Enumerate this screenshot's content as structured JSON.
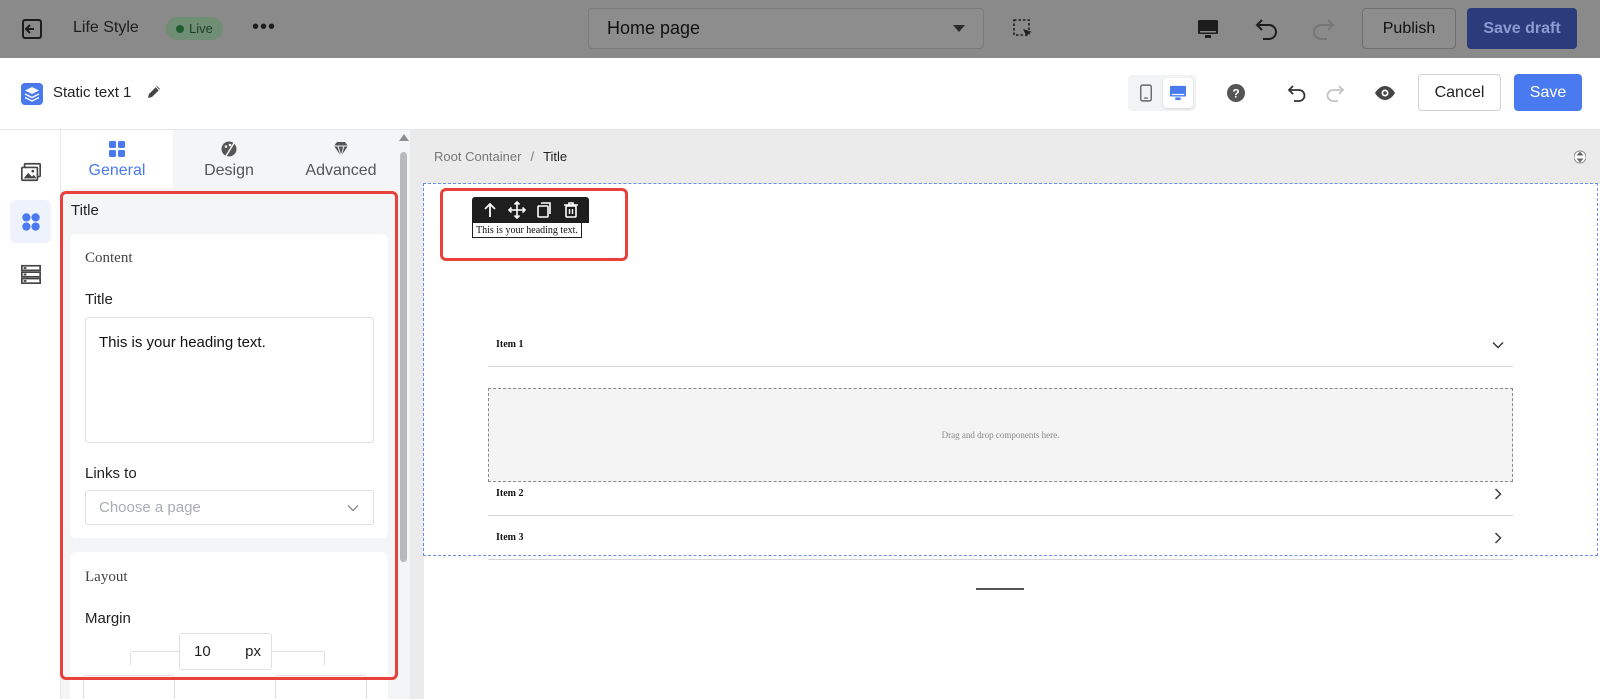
{
  "topbar": {
    "app_name": "Life Style",
    "live_badge": "Live",
    "page_select": "Home page",
    "publish": "Publish",
    "save_draft": "Save draft"
  },
  "modal_header": {
    "component_name": "Static text 1",
    "cancel": "Cancel",
    "save": "Save",
    "accent_color": "#4a7aef"
  },
  "tabs": [
    {
      "label": "General",
      "icon": "grid-icon",
      "active": true
    },
    {
      "label": "Design",
      "icon": "palette-icon",
      "active": false
    },
    {
      "label": "Advanced",
      "icon": "diamond-icon",
      "active": false
    }
  ],
  "panel": {
    "section_title": "Title",
    "content_card": {
      "label": "Content",
      "title_label": "Title",
      "title_value": "This is your heading text.",
      "links_label": "Links to",
      "links_placeholder": "Choose a page"
    },
    "layout_card": {
      "label": "Layout",
      "margin_label": "Margin",
      "margin_value": "10",
      "margin_unit": "px"
    }
  },
  "canvas": {
    "breadcrumb": [
      "Root Container",
      "/",
      "Title"
    ],
    "heading_text": "This is your heading text.",
    "accordion_items": [
      "Item 1",
      "Item 2",
      "Item 3"
    ],
    "dropzone_text": "Drag and drop components here."
  },
  "highlight_color": "#e8403a"
}
